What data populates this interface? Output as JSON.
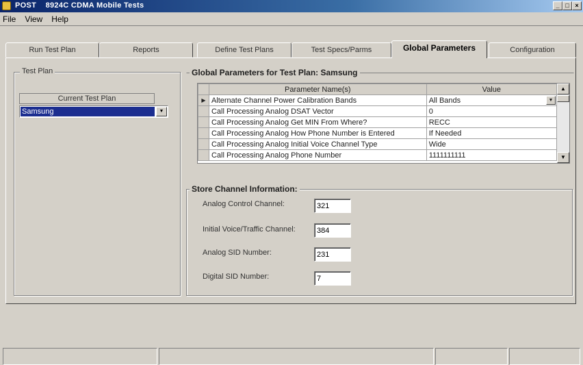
{
  "window": {
    "title": "POST    8924C CDMA Mobile Tests",
    "controls": [
      "_",
      "□",
      "×"
    ]
  },
  "menu": [
    "File",
    "View",
    "Help"
  ],
  "tabs": [
    {
      "label": "Run Test Plan",
      "active": false
    },
    {
      "label": "Reports",
      "active": false
    },
    {
      "label": "Define Test Plans",
      "active": false
    },
    {
      "label": "Test Specs/Parms",
      "active": false
    },
    {
      "label": "Global Parameters",
      "active": true
    },
    {
      "label": "Configuration",
      "active": false
    }
  ],
  "test_plan": {
    "group_title": "Test Plan",
    "current_label": "Current Test Plan",
    "selected": "Samsung"
  },
  "global_params": {
    "group_title": "Global Parameters for Test Plan: Samsung",
    "columns": [
      "Parameter Name(s)",
      "Value"
    ],
    "rows": [
      {
        "name": "Alternate Channel Power Calibration Bands",
        "value": "All Bands",
        "current": true
      },
      {
        "name": "Call Processing Analog DSAT Vector",
        "value": "0"
      },
      {
        "name": "Call Processing Analog Get MIN From Where?",
        "value": "RECC"
      },
      {
        "name": "Call Processing Analog How Phone Number is Entered",
        "value": "If Needed"
      },
      {
        "name": "Call Processing Analog Initial Voice Channel Type",
        "value": "Wide"
      },
      {
        "name": "Call Processing Analog Phone Number",
        "value": "1111111111"
      }
    ]
  },
  "store_channel": {
    "group_title": "Store Channel Information:",
    "fields": [
      {
        "label": "Analog Control Channel:",
        "value": "321"
      },
      {
        "label": "Initial Voice/Traffic Channel:",
        "value": "384"
      },
      {
        "label": "Analog SID Number:",
        "value": "231"
      },
      {
        "label": "Digital SID Number:",
        "value": "7"
      }
    ]
  },
  "colors": {
    "face": "#d4d0c8",
    "title_start": "#0a246a",
    "selection": "#1c2e90"
  }
}
